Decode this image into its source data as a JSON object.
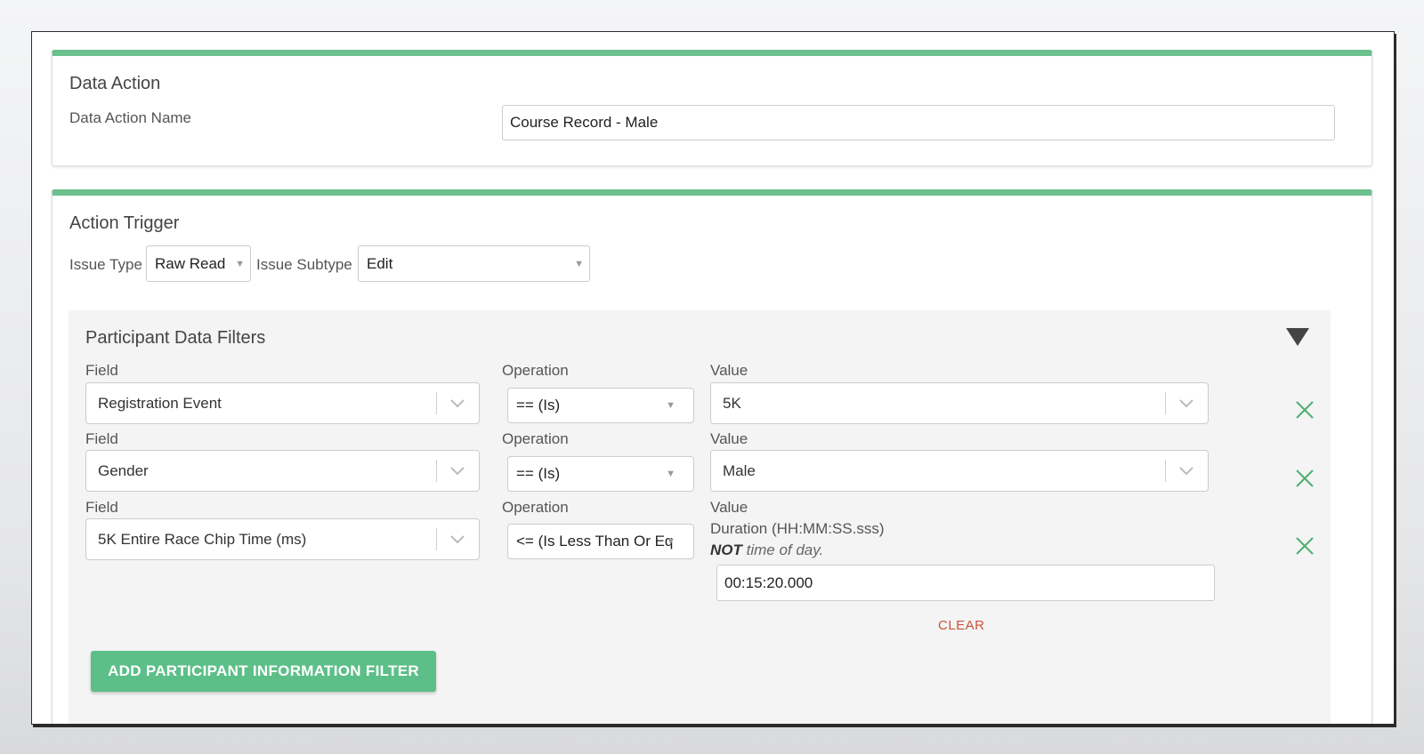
{
  "data_action": {
    "title": "Data Action",
    "name_label": "Data Action Name",
    "name_value": "Course Record - Male"
  },
  "action_trigger": {
    "title": "Action Trigger",
    "issue_type_label": "Issue Type",
    "issue_type_value": "Raw Read",
    "issue_subtype_label": "Issue Subtype",
    "issue_subtype_value": "Edit"
  },
  "filters": {
    "title": "Participant Data Filters",
    "rows": [
      {
        "field_label": "Field",
        "field_value": "Registration Event",
        "operation_label": "Operation",
        "operation_value": "== (Is)",
        "value_label": "Value",
        "value_value": "5K"
      },
      {
        "field_label": "Field",
        "field_value": "Gender",
        "operation_label": "Operation",
        "operation_value": "== (Is)",
        "value_label": "Value",
        "value_value": "Male"
      },
      {
        "field_label": "Field",
        "field_value": "5K Entire Race Chip Time (ms)",
        "operation_label": "Operation",
        "operation_value": "<= (Is Less Than Or Eq",
        "value_label": "Value",
        "duration_hint": "Duration (HH:MM:SS.sss)",
        "not_strong": "NOT",
        "not_rest": " time of day.",
        "value_value": "00:15:20.000",
        "clear_label": "CLEAR"
      }
    ],
    "add_button": "ADD PARTICIPANT INFORMATION FILTER"
  },
  "colors": {
    "accent": "#6bc08e",
    "button": "#5cbf88",
    "remove_icon": "#4caf70",
    "clear_link": "#c9543a"
  },
  "icons": {
    "dropdown": "chevron-down-icon",
    "native_select": "triangle-down-icon",
    "remove": "close-icon",
    "collapse": "triangle-down-icon"
  }
}
